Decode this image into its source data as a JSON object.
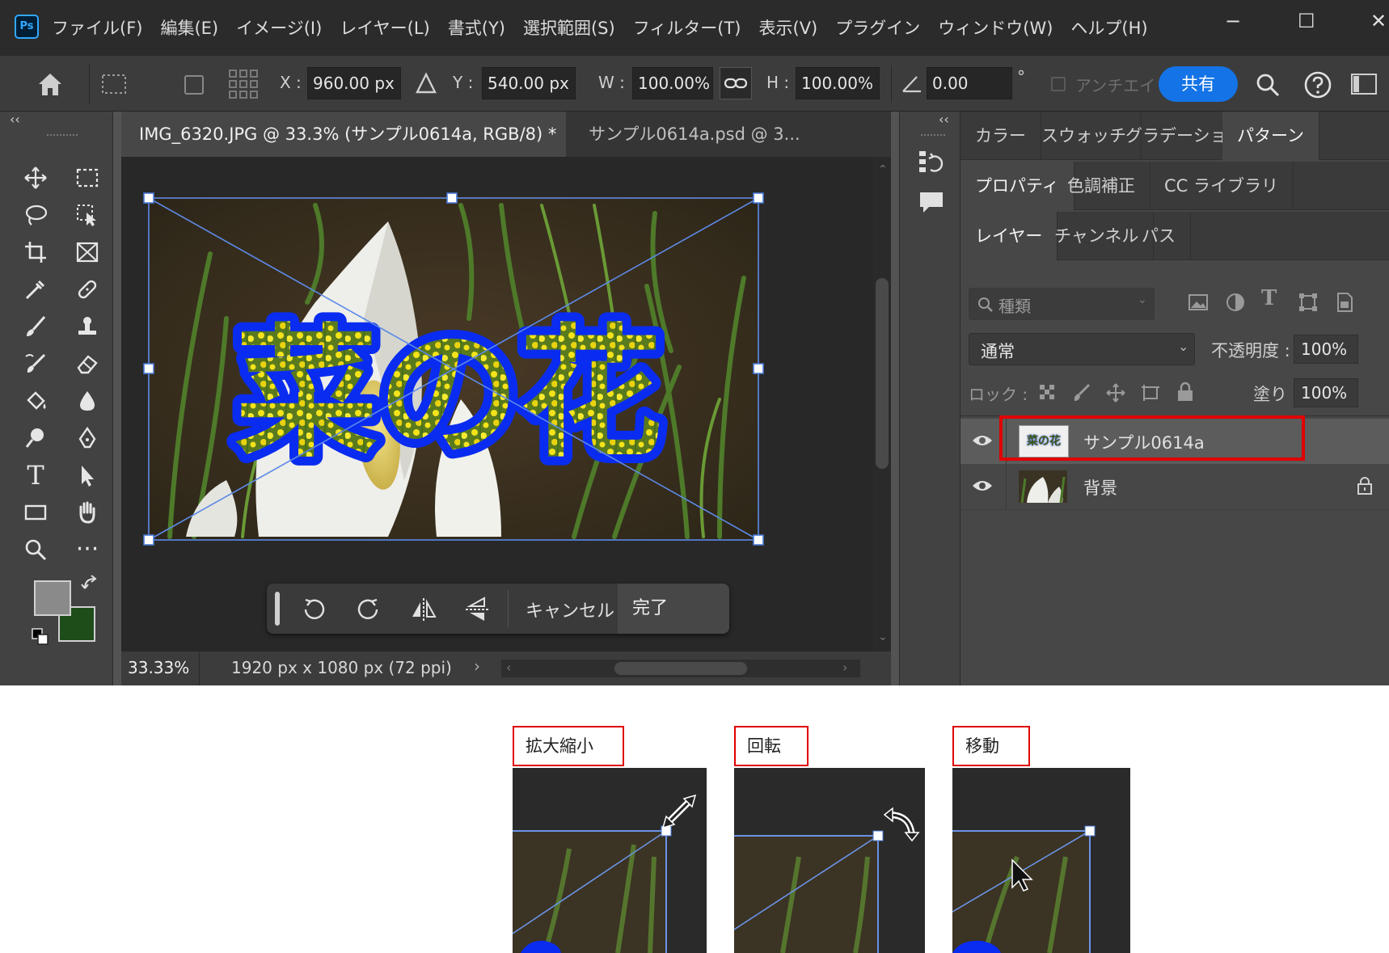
{
  "app": {
    "logo": "Ps",
    "menu": [
      "ファイル(F)",
      "編集(E)",
      "イメージ(I)",
      "レイヤー(L)",
      "書式(Y)",
      "選択範囲(S)",
      "フィルター(T)",
      "表示(V)",
      "プラグイン",
      "ウィンドウ(W)",
      "ヘルプ(H)"
    ],
    "window_controls": {
      "minimize": "−",
      "maximize": "☐",
      "close": "✕"
    }
  },
  "options": {
    "x_label": "X :",
    "x_value": "960.00 px",
    "y_label": "Y :",
    "y_value": "540.00 px",
    "w_label": "W :",
    "w_value": "100.00%",
    "h_label": "H :",
    "h_value": "100.00%",
    "angle_value": "0.00",
    "degree": "°",
    "antialias_label": "アンチエイリ",
    "share_label": "共有",
    "collapse_left": "‹‹",
    "collapse_right": "‹‹"
  },
  "document": {
    "tabs": [
      {
        "label": "IMG_6320.JPG @ 33.3% (サンプル0614a, RGB/8) *",
        "close": "×"
      },
      {
        "label": "サンプル0614a.psd @ 3...",
        "close": "×"
      }
    ],
    "canvas_text": "菜の花",
    "zoom": "33.33%",
    "doc_info": "1920 px x 1080 px (72 ppi)",
    "status_arrow": "›"
  },
  "transform_bar": {
    "cancel_label": "キャンセル",
    "done_label": "完了"
  },
  "panels": {
    "row1": [
      "カラー",
      "スウォッチ",
      "グラデーション",
      "パターン"
    ],
    "row2": [
      "プロパティ",
      "色調補正",
      "CC ライブラリ"
    ],
    "row3": [
      "レイヤー",
      "チャンネル",
      "パス"
    ],
    "filter_placeholder": "種類",
    "blend_mode": "通常",
    "opacity_label": "不透明度 :",
    "opacity_value": "100%",
    "lock_label": "ロック :",
    "fill_label": "塗り :",
    "fill_value": "100%",
    "layers": [
      {
        "name": "サンプル0614a",
        "selected": true,
        "thumb_text": "菜の花"
      },
      {
        "name": "背景",
        "selected": false
      }
    ]
  },
  "examples": [
    {
      "label": "拡大縮小",
      "cursor": "scale-cursor"
    },
    {
      "label": "回転",
      "cursor": "rotate-cursor"
    },
    {
      "label": "移動",
      "cursor": "move-cursor"
    }
  ],
  "colors": {
    "accent_blue": "#1473e6",
    "selection_red": "#e00000",
    "text_outline": "#0a2cf0",
    "text_fill": "#f2e51a",
    "background_swatch": "#1e4d1a",
    "foreground_swatch": "#8a8a8a"
  }
}
